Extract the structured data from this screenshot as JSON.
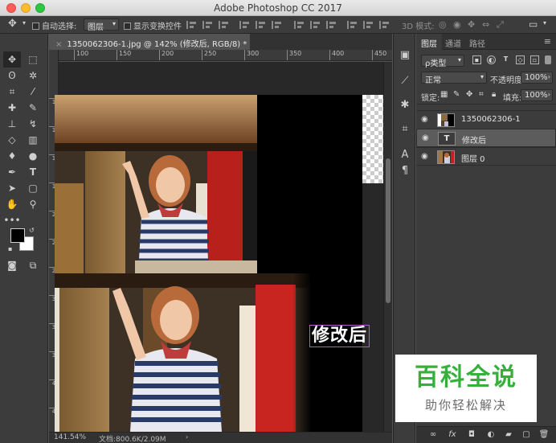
{
  "window": {
    "title": "Adobe Photoshop CC 2017"
  },
  "options_bar": {
    "auto_select_label": "自动选择:",
    "auto_select_target": "图层",
    "show_transform_label": "显示变换控件",
    "mode_3d_label": "3D 模式:"
  },
  "document": {
    "tab_title": "1350062306-1.jpg @ 142% (修改后, RGB/8) *",
    "overlay_text": "修改后",
    "ruler_ticks": [
      "100",
      "150",
      "200",
      "250",
      "300",
      "350",
      "400",
      "450"
    ],
    "ruler_v_ticks": [
      "1",
      "1",
      "1",
      "1",
      "2",
      "2",
      "2",
      "3",
      "3",
      "3",
      "4",
      "4",
      "4"
    ]
  },
  "status_bar": {
    "zoom": "141.54%",
    "doc_info": "文档:800.6K/2.09M"
  },
  "layers_panel": {
    "tabs": [
      {
        "label": "图层"
      },
      {
        "label": "通道"
      },
      {
        "label": "路径"
      }
    ],
    "kind_filter": "ρ类型",
    "blend_mode": "正常",
    "opacity_label": "不透明度:",
    "opacity_value": "100%",
    "lock_label": "锁定:",
    "fill_label": "填充:",
    "fill_value": "100%",
    "layers": [
      {
        "name": "1350062306-1",
        "selected": false
      },
      {
        "name": "修改后",
        "selected": true
      },
      {
        "name": "图层 0",
        "selected": false
      }
    ]
  },
  "watermark": {
    "title": "百科全说",
    "subtitle": "助你轻松解决"
  },
  "colors": {
    "panel_bg": "#3c3c3c",
    "pasteboard": "#282828",
    "watermark_green": "#35b13b",
    "text_stroke": "#b25bd0"
  }
}
